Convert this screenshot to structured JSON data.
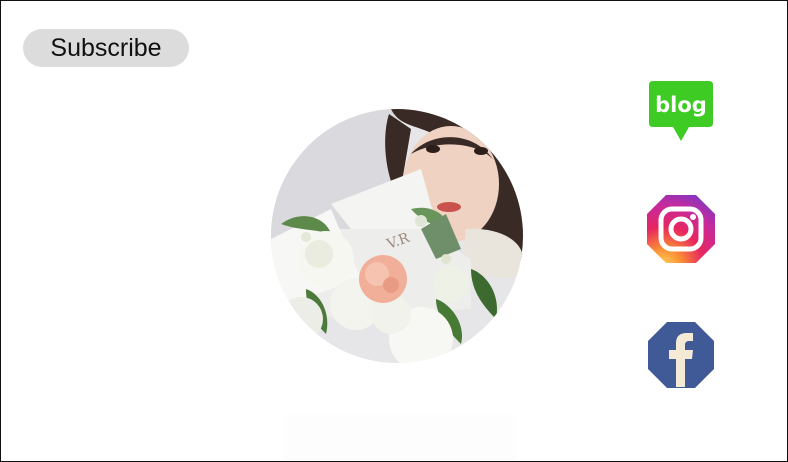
{
  "header": {
    "subscribe_label": "Subscribe"
  },
  "profile": {
    "photo_icon": "profile-photo"
  },
  "social": {
    "blog": {
      "icon": "blog-icon",
      "text": "blog",
      "color": "#3ecb24"
    },
    "instagram": {
      "icon": "instagram-icon"
    },
    "facebook": {
      "icon": "facebook-icon",
      "color": "#3f5a96",
      "glyph": "f"
    }
  },
  "colors": {
    "button_bg": "#dcdcdc",
    "border": "#111111"
  }
}
